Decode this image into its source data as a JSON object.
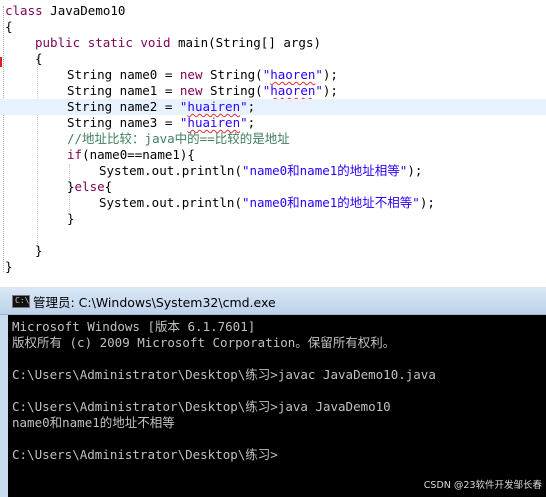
{
  "editor": {
    "lines": [
      "class JavaDemo10",
      "{",
      "public static void main(String[] args)",
      "{",
      "String name0 = new String(\"haoren\");",
      "String name1 = new String(\"haoren\");",
      "String name2 = \"huairen\";",
      "String name3 = \"huairen\";",
      "//地址比较：java中的==比较的是地址",
      "if(name0==name1){",
      "System.out.println(\"name0和name1的地址相等\");",
      "}else{",
      "System.out.println(\"name0和name1的地址不相等\");",
      "}",
      "}",
      "}"
    ]
  },
  "cmd": {
    "title": "管理员: C:\\Windows\\System32\\cmd.exe",
    "icon": "console-app-icon",
    "icon_text": "C:\\",
    "lines": [
      "Microsoft Windows [版本 6.1.7601]",
      "版权所有 (c) 2009 Microsoft Corporation。保留所有权利。",
      "C:\\Users\\Administrator\\Desktop\\练习>javac JavaDemo10.java",
      "C:\\Users\\Administrator\\Desktop\\练习>java JavaDemo10",
      "name0和name1的地址不相等",
      "C:\\Users\\Administrator\\Desktop\\练习>"
    ]
  },
  "watermark": "CSDN @23软件开发邹长春"
}
